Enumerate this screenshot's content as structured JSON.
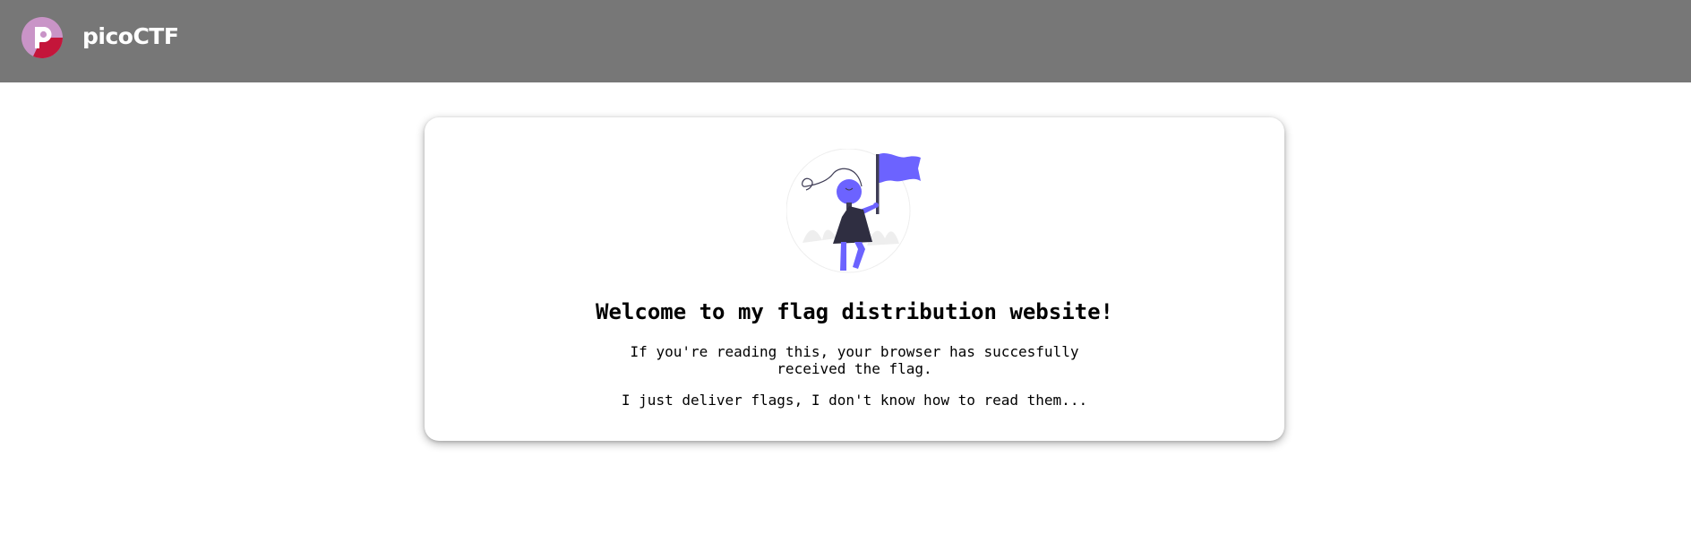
{
  "header": {
    "brand": "picoCTF",
    "logo_icon": "picoctf-logo-icon",
    "background": "#777777"
  },
  "card": {
    "title": "Welcome to my flag distribution website!",
    "line1": "If you're reading this, your browser has succesfully",
    "line2": "received the flag.",
    "line3": "I just deliver flags, I don't know how to read them...",
    "illustration": "person-holding-flag-illustration",
    "accent_color": "#6c63ff"
  }
}
